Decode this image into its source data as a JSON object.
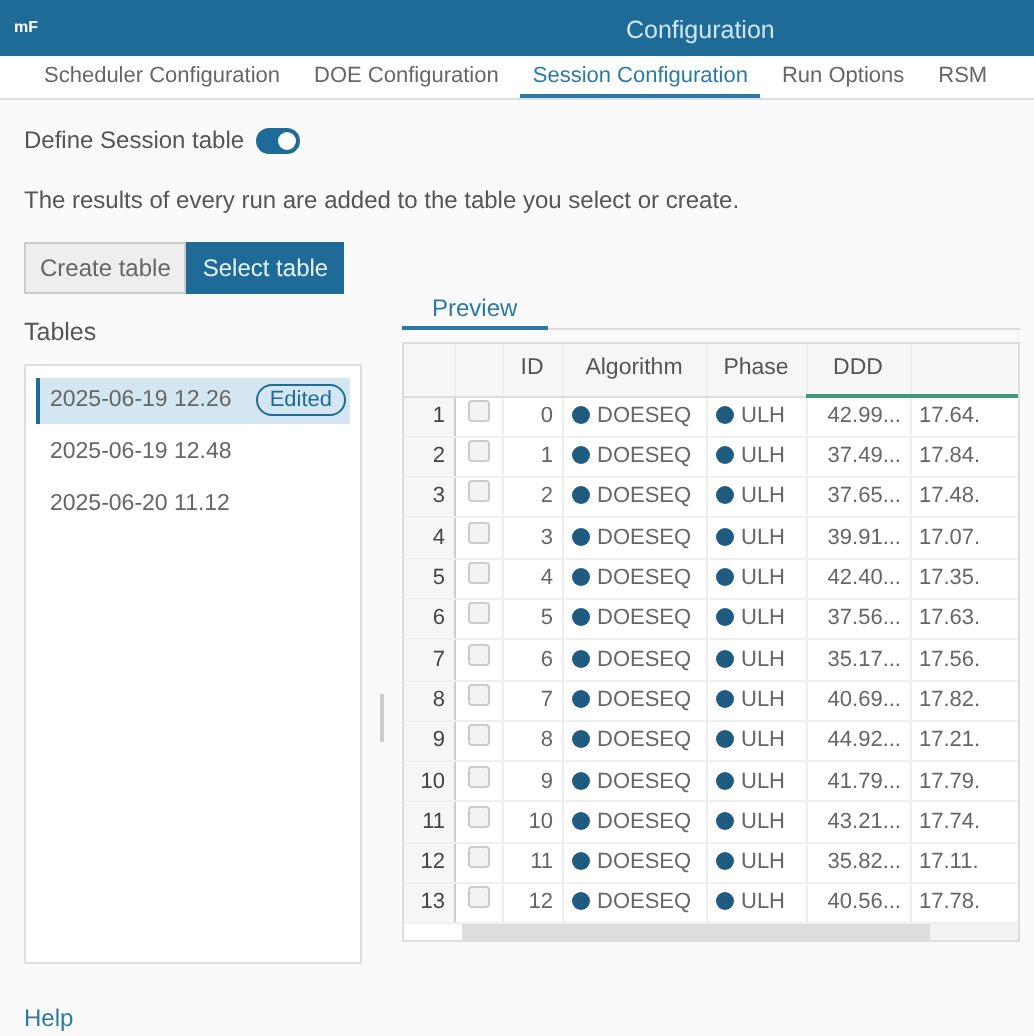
{
  "window": {
    "title": "Configuration",
    "logo": "mF"
  },
  "tabs": [
    {
      "label": "Scheduler Configuration",
      "selected": false
    },
    {
      "label": "DOE Configuration",
      "selected": false
    },
    {
      "label": "Session Configuration",
      "selected": true
    },
    {
      "label": "Run Options",
      "selected": false
    },
    {
      "label": "RSM",
      "selected": false
    }
  ],
  "define_toggle": {
    "label": "Define Session table",
    "on": true
  },
  "description": "The results of every run are added to the table you select or create.",
  "mode_buttons": [
    {
      "label": "Create table",
      "selected": false
    },
    {
      "label": "Select table",
      "selected": true
    }
  ],
  "tables": {
    "title": "Tables",
    "items": [
      {
        "label": "2025-06-19 12.26",
        "badge": "Edited",
        "selected": true
      },
      {
        "label": "2025-06-19 12.48",
        "selected": false
      },
      {
        "label": "2025-06-20 11.12",
        "selected": false
      }
    ]
  },
  "preview_tab": {
    "label": "Preview",
    "selected": true
  },
  "table": {
    "columns": [
      "",
      "",
      "ID",
      "Algorithm",
      "Phase",
      "DDD",
      ""
    ],
    "rows": [
      {
        "n": "1",
        "checked": false,
        "id": "0",
        "algorithm": "DOESEQ",
        "phase": "ULH",
        "ddd": "42.99...",
        "column_7": "17.64."
      },
      {
        "n": "2",
        "checked": false,
        "id": "1",
        "algorithm": "DOESEQ",
        "phase": "ULH",
        "ddd": "37.49...",
        "column_7": "17.84."
      },
      {
        "n": "3",
        "checked": false,
        "id": "2",
        "algorithm": "DOESEQ",
        "phase": "ULH",
        "ddd": "37.65...",
        "column_7": "17.48."
      },
      {
        "n": "4",
        "checked": false,
        "id": "3",
        "algorithm": "DOESEQ",
        "phase": "ULH",
        "ddd": "39.91...",
        "column_7": "17.07."
      },
      {
        "n": "5",
        "checked": false,
        "id": "4",
        "algorithm": "DOESEQ",
        "phase": "ULH",
        "ddd": "42.40...",
        "column_7": "17.35."
      },
      {
        "n": "6",
        "checked": false,
        "id": "5",
        "algorithm": "DOESEQ",
        "phase": "ULH",
        "ddd": "37.56...",
        "column_7": "17.63."
      },
      {
        "n": "7",
        "checked": false,
        "id": "6",
        "algorithm": "DOESEQ",
        "phase": "ULH",
        "ddd": "35.17...",
        "column_7": "17.56."
      },
      {
        "n": "8",
        "checked": false,
        "id": "7",
        "algorithm": "DOESEQ",
        "phase": "ULH",
        "ddd": "40.69...",
        "column_7": "17.82."
      },
      {
        "n": "9",
        "checked": false,
        "id": "8",
        "algorithm": "DOESEQ",
        "phase": "ULH",
        "ddd": "44.92...",
        "column_7": "17.21."
      },
      {
        "n": "10",
        "checked": false,
        "id": "9",
        "algorithm": "DOESEQ",
        "phase": "ULH",
        "ddd": "41.79...",
        "column_7": "17.79."
      },
      {
        "n": "11",
        "checked": false,
        "id": "10",
        "algorithm": "DOESEQ",
        "phase": "ULH",
        "ddd": "43.21...",
        "column_7": "17.74."
      },
      {
        "n": "12",
        "checked": false,
        "id": "11",
        "algorithm": "DOESEQ",
        "phase": "ULH",
        "ddd": "35.82...",
        "column_7": "17.11."
      },
      {
        "n": "13",
        "checked": false,
        "id": "12",
        "algorithm": "DOESEQ",
        "phase": "ULH",
        "ddd": "40.56...",
        "column_7": "17.78."
      }
    ]
  },
  "help": "Help"
}
